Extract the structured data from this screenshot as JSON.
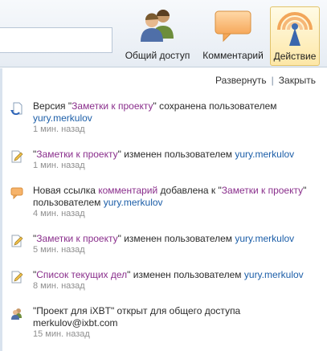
{
  "toolbar": {
    "share_label": "Общий доступ",
    "comment_label": "Комментарий",
    "action_label": "Действие",
    "share_icon": "people-icon",
    "comment_icon": "speech-bubble-icon",
    "action_icon": "broadcast-icon"
  },
  "panel": {
    "expand_label": "Развернуть",
    "separator": "|",
    "close_label": "Закрыть"
  },
  "feed": [
    {
      "icon": "page-refresh-icon",
      "pre": "Версия ",
      "quote_open": "\"",
      "link": "Заметки к проекту",
      "quote_close": "\"",
      "mid": " сохранена пользователем ",
      "user": "yury.merkulov",
      "time": "1 мин. назад"
    },
    {
      "icon": "edit-page-icon",
      "quote_open": "\"",
      "link": "Заметки к проекту",
      "quote_close": "\"",
      "mid": " изменен пользователем ",
      "user": "yury.merkulov",
      "time": "1 мин. назад"
    },
    {
      "icon": "comment-icon",
      "pre": "Новая ссылка ",
      "link1": "комментарий",
      "mid1": " добавлена к ",
      "quote_open": "\"",
      "link2": "Заметки к проекту",
      "quote_close": "\"",
      "mid2": " пользователем ",
      "user": "yury.merkulov",
      "time": "4 мин. назад"
    },
    {
      "icon": "edit-page-icon",
      "quote_open": "\"",
      "link": "Заметки к проекту",
      "quote_close": "\"",
      "mid": " изменен пользователем ",
      "user": "yury.merkulov",
      "time": "5 мин. назад"
    },
    {
      "icon": "edit-page-icon",
      "quote_open": "\"",
      "link": "Список текущих дел",
      "quote_close": "\"",
      "mid": " изменен пользователем ",
      "user": "yury.merkulov",
      "time": "8 мин. назад"
    },
    {
      "icon": "share-users-icon",
      "text": "\"Проект для iXBT\" открыт для общего доступа",
      "user": "merkulov@ixbt.com",
      "time": "15 мин. назад"
    }
  ]
}
